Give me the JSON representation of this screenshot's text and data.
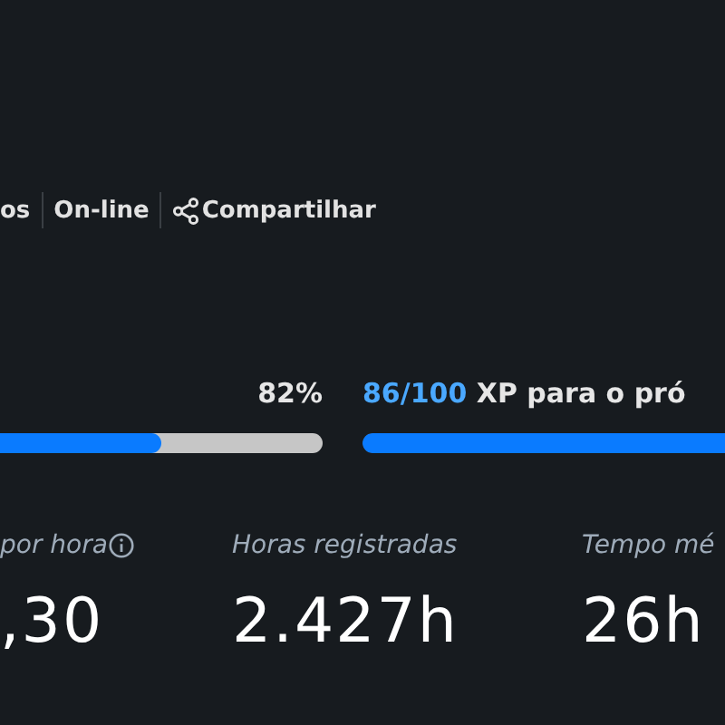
{
  "links": [
    {
      "label": "os"
    },
    {
      "label": "On-line"
    },
    {
      "label": "Compartilhar",
      "kind": "share"
    }
  ],
  "progress": [
    {
      "reading": "82%",
      "level": 0.5
    },
    {
      "highlight": "86/100",
      "text": "XP para o pró",
      "level": 1
    }
  ],
  "stats": [
    {
      "label": "por hora",
      "info": true,
      "value": ",30"
    },
    {
      "label": "Horas registradas",
      "info": false,
      "value": "2.427h"
    },
    {
      "label": "Tempo mé",
      "info": false,
      "value": "26h"
    }
  ]
}
